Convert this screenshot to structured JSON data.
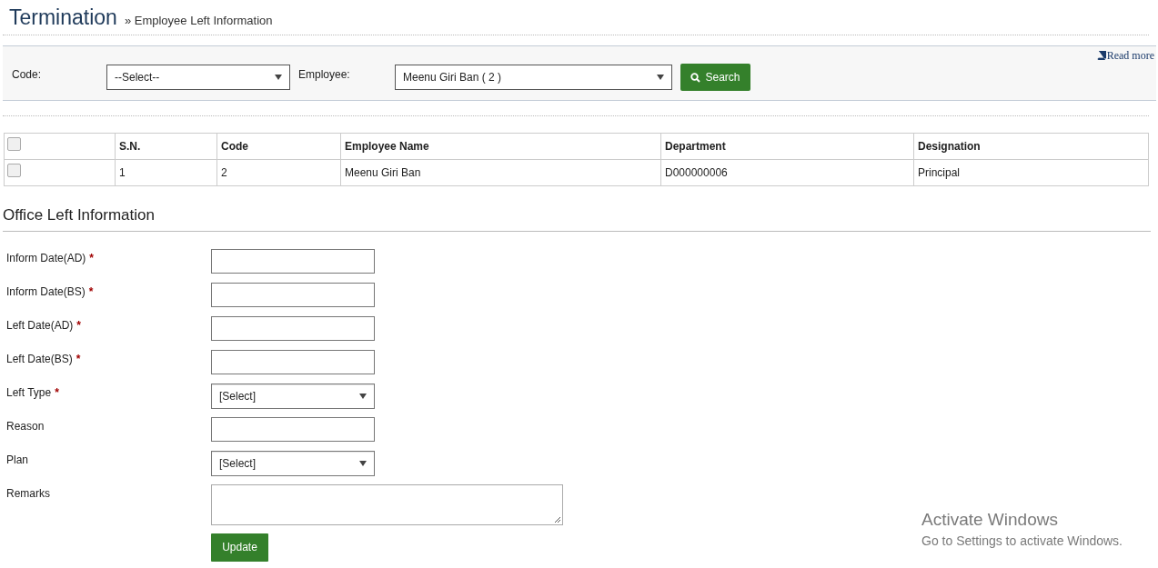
{
  "header": {
    "title": "Termination",
    "breadcrumb": "» Employee Left Information"
  },
  "filter": {
    "read_more": "Read more",
    "code": {
      "label": "Code:",
      "value": "--Select--"
    },
    "employee": {
      "label": "Employee:",
      "value": "Meenu Giri Ban ( 2 )"
    },
    "search_button": "Search"
  },
  "table": {
    "header_checked": false,
    "columns": [
      "S.N.",
      "Code",
      "Employee Name",
      "Department",
      "Designation"
    ],
    "rows": [
      {
        "checked": false,
        "cells": [
          "1",
          "2",
          "Meenu Giri Ban",
          "D000000006",
          "Principal"
        ]
      }
    ]
  },
  "section": {
    "title": "Office Left Information"
  },
  "fields": [
    {
      "label": "Inform Date(AD)",
      "required_mark": "*",
      "kind": "text"
    },
    {
      "label": "Inform Date(BS)",
      "required_mark": "*",
      "kind": "text"
    },
    {
      "label": "Left Date(AD)",
      "required_mark": "*",
      "kind": "text"
    },
    {
      "label": "Left Date(BS)",
      "required_mark": "*",
      "kind": "text"
    },
    {
      "label": "Left Type",
      "required_mark": "*",
      "kind": "select",
      "value": "[Select]"
    },
    {
      "label": "Reason",
      "kind": "text"
    },
    {
      "label": "Plan",
      "kind": "select",
      "value": "[Select]"
    },
    {
      "label": "Remarks",
      "kind": "textarea"
    }
  ],
  "update_button": "Update",
  "activation_notice": {
    "title": "Activate Windows",
    "text": "Go to Settings to activate Windows."
  }
}
